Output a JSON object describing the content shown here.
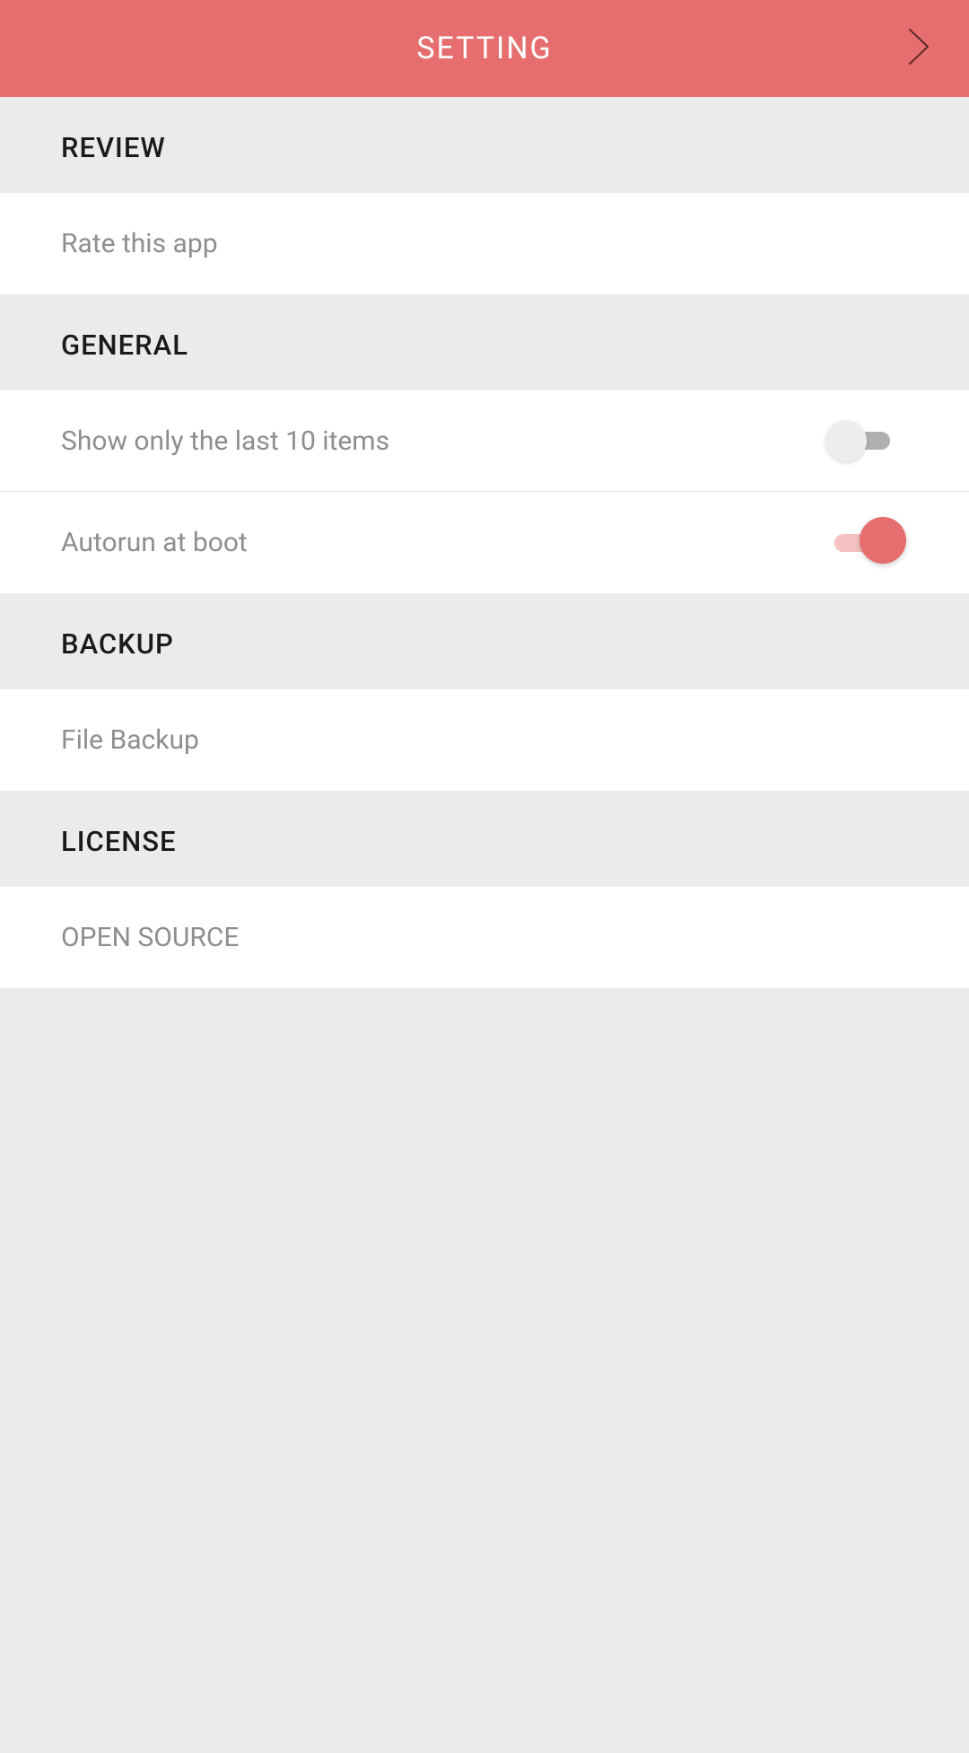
{
  "header": {
    "title": "SETTING"
  },
  "sections": {
    "review": {
      "title": "REVIEW",
      "rate_label": "Rate this app"
    },
    "general": {
      "title": "GENERAL",
      "show_last_label": "Show only the last 10 items",
      "show_last_enabled": false,
      "autorun_label": "Autorun at boot",
      "autorun_enabled": true
    },
    "backup": {
      "title": "BACKUP",
      "file_backup_label": "File Backup"
    },
    "license": {
      "title": "LICENSE",
      "open_source_label": "OPEN SOURCE"
    }
  }
}
